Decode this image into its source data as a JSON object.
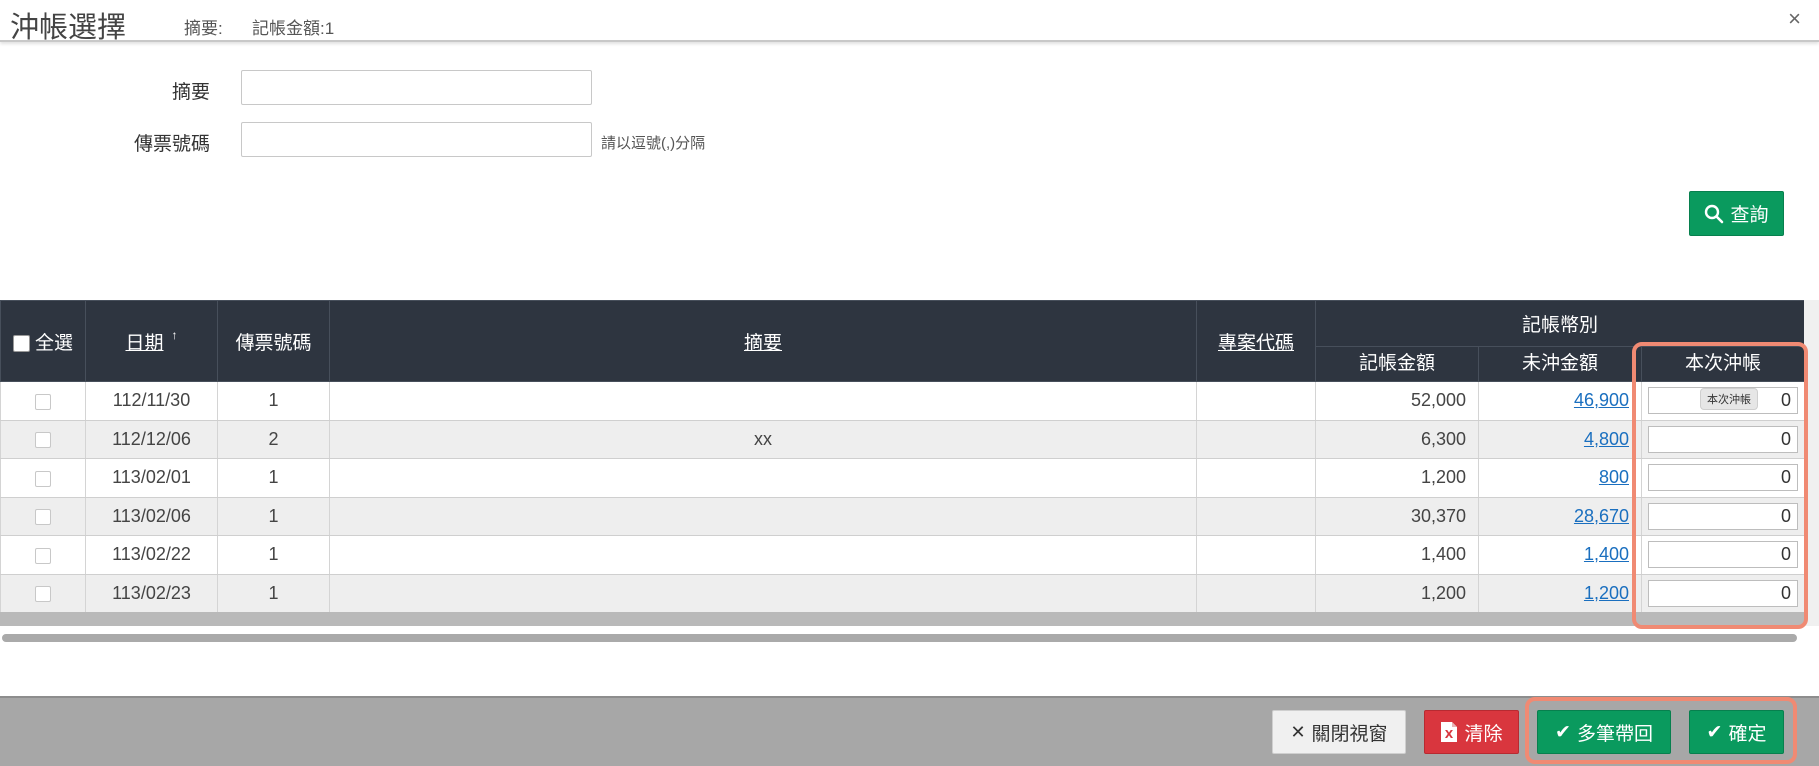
{
  "header": {
    "title": "沖帳選擇",
    "subtitle_label": "摘要:",
    "subtitle_text": "記帳金額:1",
    "close_glyph": "×"
  },
  "form": {
    "summary_label": "摘要",
    "summary_value": "",
    "voucher_label": "傳票號碼",
    "voucher_value": "",
    "voucher_hint": "請以逗號(,)分隔",
    "query_button": "查詢"
  },
  "table": {
    "headers": {
      "select_all": "全選",
      "date": "日期",
      "voucher_no": "傳票號碼",
      "summary": "摘要",
      "project_code": "專案代碼",
      "currency_group": "記帳幣別",
      "booked_amount": "記帳金額",
      "outstanding_amount": "未沖金額",
      "this_offset": "本次沖帳"
    },
    "tooltip": "本次沖帳",
    "rows": [
      {
        "date": "112/11/30",
        "voucher": "1",
        "summary": "",
        "project": "",
        "booked": "52,000",
        "outstanding": "46,900",
        "offset": "0"
      },
      {
        "date": "112/12/06",
        "voucher": "2",
        "summary": "xx",
        "project": "",
        "booked": "6,300",
        "outstanding": "4,800",
        "offset": "0"
      },
      {
        "date": "113/02/01",
        "voucher": "1",
        "summary": "",
        "project": "",
        "booked": "1,200",
        "outstanding": "800",
        "offset": "0"
      },
      {
        "date": "113/02/06",
        "voucher": "1",
        "summary": "",
        "project": "",
        "booked": "30,370",
        "outstanding": "28,670",
        "offset": "0"
      },
      {
        "date": "113/02/22",
        "voucher": "1",
        "summary": "",
        "project": "",
        "booked": "1,400",
        "outstanding": "1,400",
        "offset": "0"
      },
      {
        "date": "113/02/23",
        "voucher": "1",
        "summary": "",
        "project": "",
        "booked": "1,200",
        "outstanding": "1,200",
        "offset": "0"
      }
    ]
  },
  "footer": {
    "close_window": "關閉視窗",
    "clear": "清除",
    "multi_return": "多筆帶回",
    "confirm": "確定"
  },
  "colors": {
    "green": "#0a9a5e",
    "red": "#d9363e",
    "header_dark": "#2e3540",
    "link_blue": "#1a6fbf",
    "highlight": "#f08a73"
  }
}
